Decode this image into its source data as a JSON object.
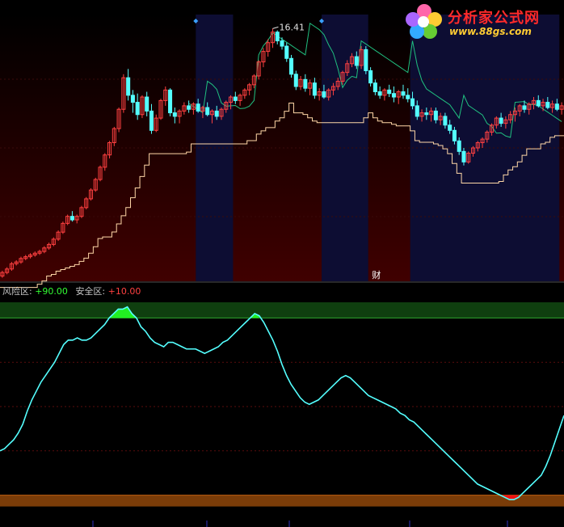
{
  "logo": {
    "title": "分析家公式网",
    "url": "www.88gs.com"
  },
  "indicator": {
    "risk_label": "风险区:",
    "risk_value": "+90.00",
    "safe_label": "安全区:",
    "safe_value": "+10.00"
  },
  "colors": {
    "up_candle": "#ff4040",
    "down_candle": "#54ffff",
    "stair_line": "#ffd8a8",
    "trail_line": "#20c080",
    "oscillator": "#54ffff",
    "risk_fill": "#22ee22",
    "safe_fill": "#ee1111",
    "risk_band": "#0f3f0f",
    "safe_band": "#7a3c08",
    "background_red": "#400000",
    "background_blue": "#0d0d33"
  },
  "chart_data": [
    {
      "type": "candlestick",
      "title": "",
      "ylim": [
        2,
        17.2
      ],
      "x_count": 125,
      "annotations": {
        "max_price_label": "16.41",
        "finance_marker": "财"
      },
      "blue_zones": [
        [
          42,
          50
        ],
        [
          69,
          79
        ],
        [
          88,
          120
        ]
      ],
      "candles": [
        [
          2.3,
          2.6,
          2.2,
          2.5
        ],
        [
          2.5,
          2.8,
          2.4,
          2.7
        ],
        [
          2.7,
          3.1,
          2.6,
          3.0
        ],
        [
          3.0,
          3.2,
          2.9,
          3.1
        ],
        [
          3.1,
          3.4,
          3.0,
          3.3
        ],
        [
          3.3,
          3.5,
          3.2,
          3.4
        ],
        [
          3.4,
          3.6,
          3.3,
          3.5
        ],
        [
          3.5,
          3.7,
          3.4,
          3.6
        ],
        [
          3.6,
          3.8,
          3.5,
          3.7
        ],
        [
          3.7,
          4.0,
          3.6,
          3.9
        ],
        [
          3.9,
          4.2,
          3.8,
          4.1
        ],
        [
          4.1,
          4.5,
          4.0,
          4.4
        ],
        [
          4.4,
          4.9,
          4.3,
          4.8
        ],
        [
          4.8,
          5.4,
          4.7,
          5.3
        ],
        [
          5.3,
          5.8,
          5.2,
          5.7
        ],
        [
          5.7,
          6.0,
          5.4,
          5.5
        ],
        [
          5.5,
          5.8,
          5.3,
          5.7
        ],
        [
          5.7,
          6.3,
          5.6,
          6.2
        ],
        [
          6.2,
          6.8,
          6.1,
          6.7
        ],
        [
          6.7,
          7.3,
          6.6,
          7.2
        ],
        [
          7.2,
          7.9,
          7.1,
          7.8
        ],
        [
          7.8,
          8.6,
          7.7,
          8.5
        ],
        [
          8.5,
          9.3,
          8.3,
          9.2
        ],
        [
          9.2,
          10.0,
          9.0,
          9.9
        ],
        [
          9.9,
          10.8,
          9.7,
          10.7
        ],
        [
          10.7,
          11.9,
          10.5,
          11.8
        ],
        [
          11.8,
          13.8,
          11.6,
          13.6
        ],
        [
          13.6,
          14.1,
          12.3,
          12.6
        ],
        [
          12.6,
          12.9,
          11.6,
          12.2
        ],
        [
          12.2,
          12.7,
          11.2,
          11.5
        ],
        [
          11.5,
          12.6,
          11.3,
          12.5
        ],
        [
          12.5,
          12.8,
          11.4,
          11.7
        ],
        [
          11.7,
          12.1,
          10.4,
          10.6
        ],
        [
          10.6,
          11.5,
          10.5,
          11.3
        ],
        [
          11.3,
          12.4,
          11.2,
          12.3
        ],
        [
          12.3,
          13.1,
          12.0,
          12.9
        ],
        [
          12.9,
          13.0,
          11.4,
          11.6
        ],
        [
          11.6,
          11.9,
          11.0,
          11.4
        ],
        [
          11.4,
          11.8,
          11.0,
          11.7
        ],
        [
          11.7,
          12.2,
          11.5,
          12.0
        ],
        [
          12.0,
          12.3,
          11.6,
          11.8
        ],
        [
          11.8,
          12.2,
          11.5,
          12.1
        ],
        [
          12.1,
          12.4,
          11.6,
          11.7
        ],
        [
          11.7,
          12.0,
          11.3,
          11.9
        ],
        [
          11.9,
          12.2,
          11.4,
          11.5
        ],
        [
          11.5,
          11.8,
          11.0,
          11.7
        ],
        [
          11.7,
          12.0,
          11.2,
          11.4
        ],
        [
          11.4,
          11.9,
          11.2,
          11.8
        ],
        [
          11.8,
          12.3,
          11.6,
          12.2
        ],
        [
          12.2,
          12.6,
          11.8,
          12.5
        ],
        [
          12.5,
          12.8,
          12.1,
          12.3
        ],
        [
          12.3,
          12.7,
          12.0,
          12.6
        ],
        [
          12.6,
          13.0,
          12.4,
          12.9
        ],
        [
          12.9,
          13.3,
          12.6,
          13.2
        ],
        [
          13.2,
          13.8,
          13.0,
          13.7
        ],
        [
          13.7,
          14.6,
          13.5,
          14.5
        ],
        [
          14.5,
          15.3,
          14.2,
          15.1
        ],
        [
          15.1,
          15.8,
          14.8,
          15.6
        ],
        [
          15.6,
          16.4,
          15.3,
          16.2
        ],
        [
          16.2,
          16.3,
          15.5,
          15.7
        ],
        [
          15.7,
          15.9,
          15.2,
          15.4
        ],
        [
          15.4,
          15.6,
          14.5,
          14.7
        ],
        [
          14.7,
          14.9,
          13.6,
          13.8
        ],
        [
          13.8,
          14.0,
          12.9,
          13.1
        ],
        [
          13.1,
          13.7,
          12.9,
          13.5
        ],
        [
          13.5,
          13.8,
          12.8,
          13.0
        ],
        [
          13.0,
          13.5,
          12.6,
          13.3
        ],
        [
          13.3,
          13.6,
          12.4,
          12.6
        ],
        [
          12.6,
          13.0,
          12.3,
          12.8
        ],
        [
          12.8,
          13.2,
          12.4,
          12.5
        ],
        [
          12.5,
          13.0,
          12.3,
          12.9
        ],
        [
          12.9,
          13.3,
          12.6,
          13.1
        ],
        [
          13.1,
          13.6,
          12.9,
          13.4
        ],
        [
          13.4,
          14.0,
          13.2,
          13.9
        ],
        [
          13.9,
          14.6,
          13.7,
          14.4
        ],
        [
          14.4,
          15.0,
          14.2,
          14.8
        ],
        [
          14.8,
          15.1,
          14.1,
          14.3
        ],
        [
          14.3,
          15.4,
          14.1,
          15.2
        ],
        [
          15.2,
          15.4,
          13.8,
          14.0
        ],
        [
          14.0,
          14.2,
          13.1,
          13.3
        ],
        [
          13.3,
          13.5,
          12.6,
          12.8
        ],
        [
          12.8,
          13.1,
          12.4,
          12.6
        ],
        [
          12.6,
          13.0,
          12.3,
          12.9
        ],
        [
          12.9,
          13.2,
          12.5,
          12.7
        ],
        [
          12.7,
          13.1,
          12.2,
          12.5
        ],
        [
          12.5,
          12.9,
          12.1,
          12.8
        ],
        [
          12.8,
          13.2,
          12.4,
          12.6
        ],
        [
          12.6,
          13.0,
          12.2,
          12.4
        ],
        [
          12.4,
          12.8,
          11.8,
          12.0
        ],
        [
          12.0,
          12.3,
          11.2,
          11.4
        ],
        [
          11.4,
          11.8,
          11.1,
          11.6
        ],
        [
          11.6,
          11.9,
          11.2,
          11.5
        ],
        [
          11.5,
          11.9,
          11.1,
          11.7
        ],
        [
          11.7,
          11.9,
          11.0,
          11.2
        ],
        [
          11.2,
          11.6,
          10.9,
          11.4
        ],
        [
          11.4,
          11.6,
          10.7,
          10.9
        ],
        [
          10.9,
          11.2,
          10.4,
          10.6
        ],
        [
          10.6,
          10.8,
          9.8,
          10.0
        ],
        [
          10.0,
          10.2,
          9.2,
          9.4
        ],
        [
          9.4,
          9.6,
          8.6,
          8.8
        ],
        [
          8.8,
          9.4,
          8.7,
          9.3
        ],
        [
          9.3,
          9.7,
          9.1,
          9.6
        ],
        [
          9.6,
          10.0,
          9.4,
          9.9
        ],
        [
          9.9,
          10.2,
          9.6,
          10.1
        ],
        [
          10.1,
          10.6,
          9.9,
          10.5
        ],
        [
          10.5,
          11.0,
          10.3,
          10.9
        ],
        [
          10.9,
          11.4,
          10.7,
          11.3
        ],
        [
          11.3,
          11.6,
          10.8,
          11.0
        ],
        [
          11.0,
          11.4,
          10.7,
          11.2
        ],
        [
          11.2,
          11.7,
          11.0,
          11.5
        ],
        [
          11.5,
          11.9,
          11.1,
          11.7
        ],
        [
          11.7,
          12.1,
          11.4,
          12.0
        ],
        [
          12.0,
          12.3,
          11.6,
          11.8
        ],
        [
          11.8,
          12.2,
          11.5,
          12.1
        ],
        [
          12.1,
          12.5,
          11.8,
          12.3
        ],
        [
          12.3,
          12.6,
          11.9,
          12.0
        ],
        [
          12.0,
          12.4,
          11.7,
          12.2
        ],
        [
          12.2,
          12.5,
          11.8,
          11.9
        ],
        [
          11.9,
          12.3,
          11.6,
          12.1
        ],
        [
          12.1,
          12.4,
          11.7,
          11.8
        ],
        [
          11.8,
          12.2,
          11.5,
          12.0
        ]
      ]
    },
    {
      "type": "line",
      "title": "",
      "ylim": [
        0,
        100
      ],
      "thresholds": {
        "risk": 90,
        "safe": 10
      },
      "series": [
        {
          "values": [
            30,
            31,
            33,
            35,
            38,
            42,
            48,
            53,
            57,
            61,
            64,
            67,
            70,
            74,
            78,
            80,
            80,
            81,
            80,
            80,
            81,
            83,
            85,
            87,
            90,
            92,
            94,
            94,
            95,
            92,
            90,
            86,
            84,
            81,
            79,
            78,
            77,
            79,
            79,
            78,
            77,
            76,
            76,
            76,
            75,
            74,
            75,
            76,
            77,
            79,
            80,
            82,
            84,
            86,
            88,
            90,
            92,
            91,
            88,
            84,
            80,
            75,
            69,
            64,
            60,
            57,
            54,
            52,
            51,
            52,
            53,
            55,
            57,
            59,
            61,
            63,
            64,
            63,
            61,
            59,
            57,
            55,
            54,
            53,
            52,
            51,
            50,
            49,
            47,
            46,
            44,
            43,
            41,
            39,
            37,
            35,
            33,
            31,
            29,
            27,
            25,
            23,
            21,
            19,
            17,
            15,
            14,
            13,
            12,
            11,
            10,
            9,
            8,
            8,
            9,
            11,
            13,
            15,
            17,
            19,
            23,
            28,
            34,
            40,
            46
          ]
        }
      ]
    }
  ]
}
